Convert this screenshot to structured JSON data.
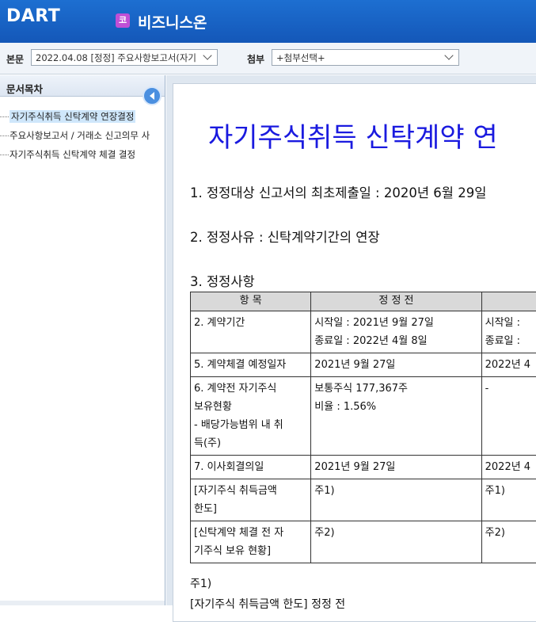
{
  "header": {
    "logo": "DART",
    "biz_badge": "코",
    "biz_title": "비즈니스온"
  },
  "toolbar": {
    "main_label": "본문",
    "main_select": "2022.04.08  [정정] 주요사항보고서(자기",
    "attach_label": "첨부",
    "attach_select": "+첨부선택+"
  },
  "sidebar": {
    "title": "문서목차",
    "items": [
      {
        "label": "자기주식취득 신탁계약 연장결정",
        "active": true
      },
      {
        "label": "주요사항보고서 / 거래소 신고의무 사",
        "active": false
      },
      {
        "label": "자기주식취득 신탁계약 체결 결정",
        "active": false
      }
    ]
  },
  "doc": {
    "title": "자기주식취득 신탁계약 연",
    "p1": "1. 정정대상 신고서의 최초제출일 : 2020년 6월 29일",
    "p2": "2. 정정사유 : 신탁계약기간의 연장",
    "p3": "3. 정정사항",
    "table": {
      "headers": [
        "항 목",
        "정 정 전",
        ""
      ],
      "rows": [
        {
          "c1": [
            "2. 계약기간"
          ],
          "c2": [
            "시작일 : 2021년 9월 27일",
            "종료일 : 2022년 4월 8일"
          ],
          "c3": [
            "시작일 :",
            "종료일 :"
          ]
        },
        {
          "c1": [
            "5. 계약체결 예정일자"
          ],
          "c2": [
            "2021년 9월 27일"
          ],
          "c3": [
            "2022년 4"
          ]
        },
        {
          "c1": [
            "6. 계약전 자기주식",
            "보유현황",
            "- 배당가능범위 내 취",
            "득(주)"
          ],
          "c2": [
            "보통주식 177,367주",
            "비율 : 1.56%"
          ],
          "c3": [
            "-"
          ]
        },
        {
          "c1": [
            "7. 이사회결의일"
          ],
          "c2": [
            "2021년 9월 27일"
          ],
          "c3": [
            "2022년 4"
          ]
        },
        {
          "c1": [
            "[자기주식 취득금액",
            "한도]"
          ],
          "c2": [
            "주1)"
          ],
          "c3": [
            "주1)"
          ]
        },
        {
          "c1": [
            "[신탁계약 체결 전 자",
            "기주식 보유 현황]"
          ],
          "c2": [
            "주2)"
          ],
          "c3": [
            "주2)"
          ]
        }
      ]
    },
    "note1": "주1)",
    "note2": "[자기주식 취득금액 한도] 정정 전"
  }
}
